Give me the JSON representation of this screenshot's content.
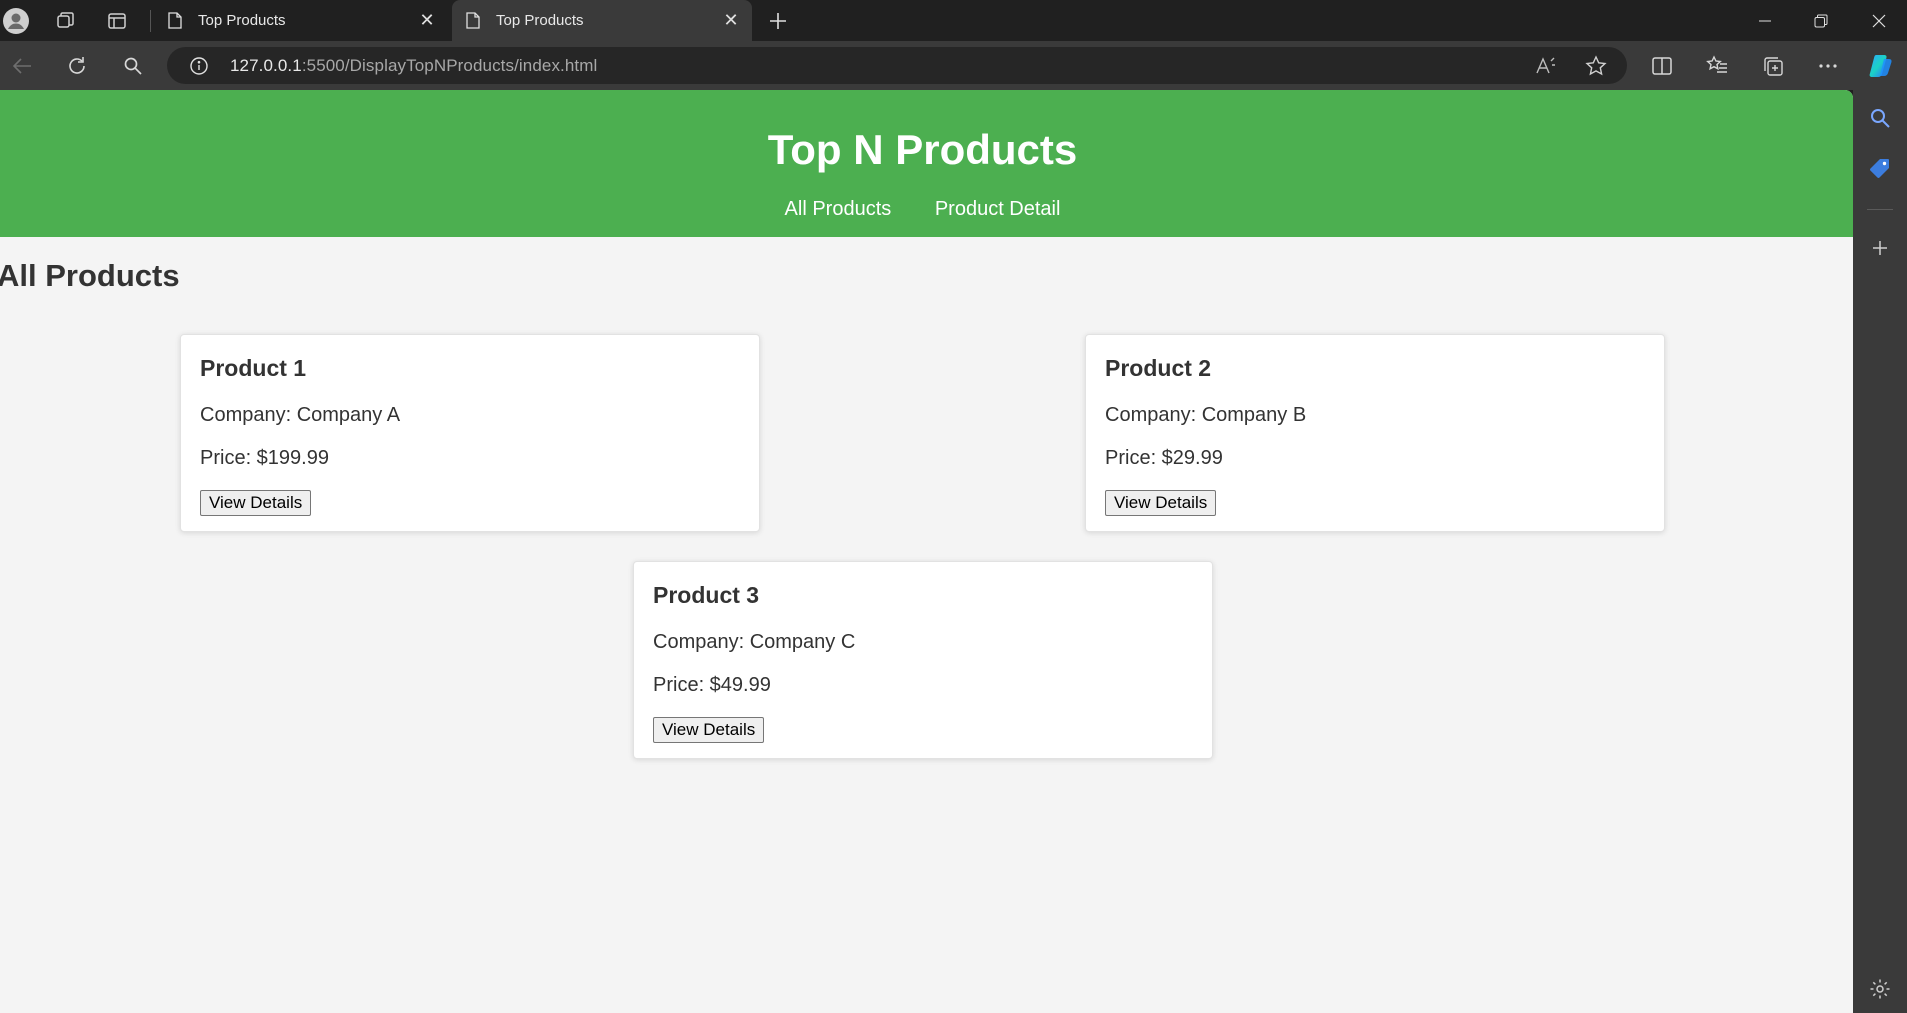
{
  "browser": {
    "tabs": [
      {
        "title": "Top Products",
        "active": false
      },
      {
        "title": "Top Products",
        "active": true
      }
    ],
    "url_host": "127.0.0.1",
    "url_rest": ":5500/DisplayTopNProducts/index.html"
  },
  "page": {
    "title": "Top N Products",
    "nav": [
      "All Products",
      "Product Detail"
    ],
    "section_title": "All Products",
    "button_label": "View Details",
    "products": [
      {
        "name": "Product 1",
        "company": "Company: Company A",
        "price": "Price: $199.99"
      },
      {
        "name": "Product 2",
        "company": "Company: Company B",
        "price": "Price: $29.99"
      },
      {
        "name": "Product 3",
        "company": "Company: Company C",
        "price": "Price: $49.99"
      }
    ]
  },
  "colors": {
    "header_green": "#4caf50",
    "page_background": "#f4f4f4",
    "browser_chrome": "#202020"
  }
}
